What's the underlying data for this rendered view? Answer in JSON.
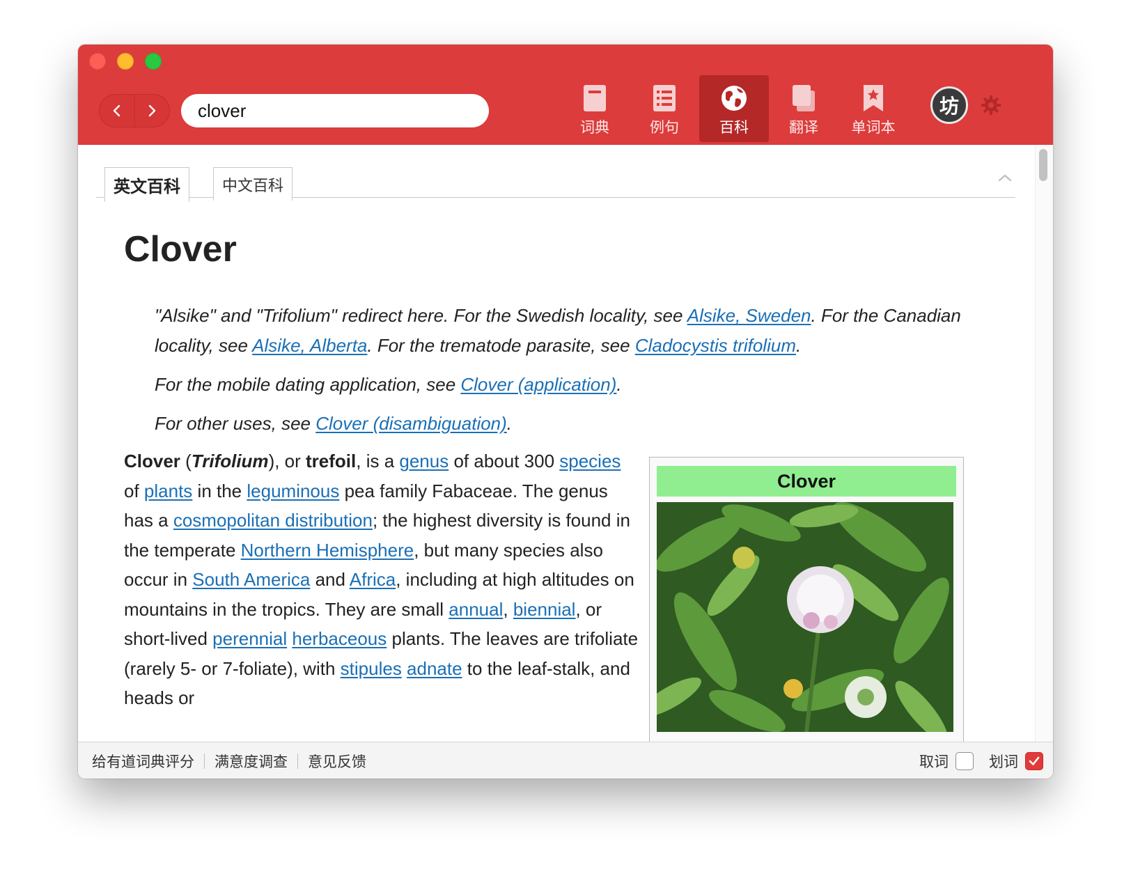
{
  "colors": {
    "toolbar": "#dc3c3c",
    "toolbar_active": "#b52828",
    "link": "#1a6fb5",
    "infobox_header": "#90ee90",
    "checkbox_on": "#e03b3b"
  },
  "search": {
    "value": "clover"
  },
  "modes": [
    {
      "label": "词典",
      "icon": "dictionary-icon",
      "active": false
    },
    {
      "label": "例句",
      "icon": "sentences-list-icon",
      "active": false
    },
    {
      "label": "百科",
      "icon": "globe-icon",
      "active": true
    },
    {
      "label": "翻译",
      "icon": "translate-icon",
      "active": false
    },
    {
      "label": "单词本",
      "icon": "bookmark-star-icon",
      "active": false
    }
  ],
  "avatar": {
    "initial": "坊"
  },
  "tabs": {
    "english": "英文百科",
    "chinese": "中文百科"
  },
  "article": {
    "title": "Clover",
    "hatnote1": {
      "pre": "\"Alsike\" and \"Trifolium\" redirect here. For the Swedish locality, see ",
      "link1": "Alsike, Sweden",
      "mid1": ". For the Canadian locality, see ",
      "link2": "Alsike, Alberta",
      "mid2": ". For the trematode parasite, see ",
      "link3": "Cladocystis trifolium",
      "end": "."
    },
    "hatnote2": {
      "pre": "For the mobile dating application, see ",
      "link": "Clover (application)",
      "end": "."
    },
    "hatnote3": {
      "pre": "For other uses, see ",
      "link": "Clover (disambiguation)",
      "end": "."
    },
    "body": {
      "b1": "Clover",
      "t1": " (",
      "bi1": "Trifolium",
      "t2": "), or ",
      "b2": "trefoil",
      "t3": ", is a ",
      "l_genus": "genus",
      "t4": " of about 300 ",
      "l_species": "species",
      "t5": " of ",
      "l_plants": "plants",
      "t6": " in the ",
      "l_leguminous": "leguminous",
      "t7": " pea family Fabaceae. The genus has a ",
      "l_cosmo": "cosmopolitan distribution",
      "t8": "; the highest diversity is found in the temperate ",
      "l_north": "Northern Hemisphere",
      "t9": ", but many species also occur in ",
      "l_south": "South America",
      "t10": " and ",
      "l_africa": "Africa",
      "t11": ", including at high altitudes on mountains in the tropics. They are small ",
      "l_annual": "annual",
      "t12": ", ",
      "l_biennial": "biennial",
      "t13": ", or short-lived ",
      "l_perennial": "perennial",
      "t14": " ",
      "l_herbaceous": "herbaceous",
      "t15": " plants. The leaves are trifoliate (rarely 5- or 7-foliate), with ",
      "l_stipules": "stipules",
      "t16": " ",
      "l_adnate": "adnate",
      "t17": " to the leaf-stalk, and heads or"
    },
    "infobox": {
      "title": "Clover"
    }
  },
  "statusbar": {
    "links": [
      "给有道词典评分",
      "满意度调查",
      "意见反馈"
    ],
    "toggle_cancel": {
      "label": "取词",
      "checked": false
    },
    "toggle_select": {
      "label": "划词",
      "checked": true
    }
  }
}
